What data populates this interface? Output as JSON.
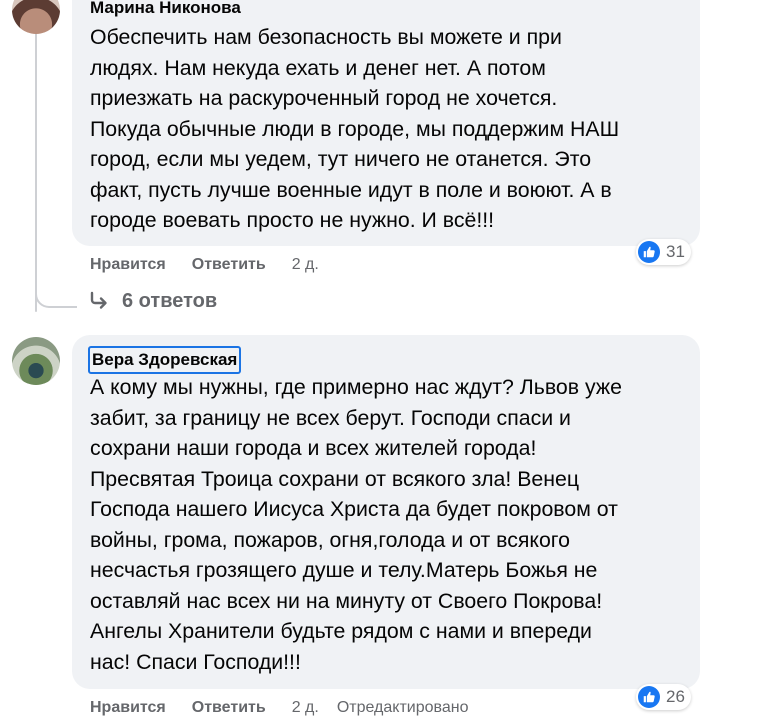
{
  "comment1": {
    "author": "Марина Никонова",
    "text": "Обеспечить нам безопасность вы можете и при\nлюдях. Нам некуда ехать и денег нет. А потом\nприезжать на раскуроченный город не хочется.\nПокуда обычные люди в городе, мы поддержим НАШ\nгород, если мы уедем, тут ничего не отанется. Это\nфакт, пусть лучше военные идут в поле и воюют. А в\nгороде воевать просто не нужно. И всё!!!",
    "like_label": "Нравится",
    "reply_label": "Ответить",
    "time": "2 д.",
    "reaction_count": "31",
    "reaction_icon": "like-icon"
  },
  "replies_link": {
    "label": "6 ответов",
    "icon": "reply-arrow-icon"
  },
  "comment2": {
    "author": "Вера Здоревская",
    "text": "А кому мы нужны, где примерно нас ждут? Львов уже\nзабит, за границу не всех берут. Господи спаси и\nсохрани наши города и всех жителей города!\nПресвятая Троица сохрани от всякого зла! Венец\nГоспода нашего Иисуса Христа да будет покровом от\nвойны, грома, пожаров, огня,голода и от всякого\nнесчастья грозящего душе и телу.Матерь Божья не\nоставляй нас всех ни на минуту от Своего Покрова!\nАнгелы Хранители будьте рядом с нами и впереди\nнас! Спаси Господи!!!",
    "like_label": "Нравится",
    "reply_label": "Ответить",
    "time": "2 д.",
    "edited_label": "Отредактировано",
    "reaction_count": "26",
    "reaction_icon": "like-icon"
  },
  "colors": {
    "bubble": "#f0f2f5",
    "secondary_text": "#65676b",
    "like_blue": "#1877f2",
    "focus_outline": "#1b74e4"
  }
}
